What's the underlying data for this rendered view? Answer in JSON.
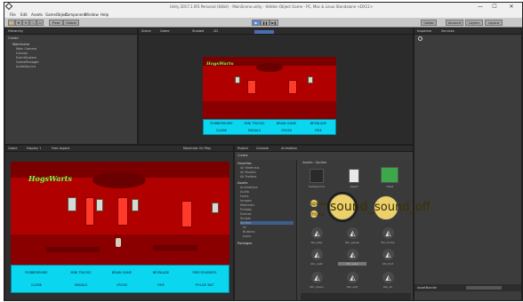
{
  "window": {
    "title": "Unity 2017.1.0f3 Personal (64bit) - MainScene.unity - Hidden Object Game - PC, Mac & Linux Standalone <DX11>",
    "minimize": "—",
    "maximize": "☐",
    "close": "✕"
  },
  "menu": [
    "File",
    "Edit",
    "Assets",
    "GameObject",
    "Component",
    "Window",
    "Help"
  ],
  "toolbar": {
    "tools": [
      "✋",
      "✥",
      "⟲",
      "⤡",
      "▭"
    ],
    "pivot": "Pivot",
    "global": "Global",
    "play": "▶",
    "pause": "❚❚",
    "step": "▶❚",
    "collab": "Collab",
    "account": "Account",
    "layers": "Layers",
    "layout": "Layout"
  },
  "hierarchy": {
    "tab": "Hierarchy",
    "create": "Create",
    "items": [
      "MainScene",
      "Main Camera",
      "Canvas",
      "EventSystem",
      "GameManager",
      "AudioSource"
    ]
  },
  "scene": {
    "tab": "Scene",
    "tab2": "Game",
    "shaded": "Shaded",
    "mode": "2D"
  },
  "game": {
    "tab": "Game",
    "display": "Display 1",
    "aspect": "Free Aspect",
    "maximize": "Maximize On Play"
  },
  "logo": "HogsWarts",
  "word_grid": [
    [
      "ROBBERSHIRE",
      "MINI TRUCKS",
      "BRAIN GAME",
      "BEYBLADE",
      "PRECIOUSNESS"
    ],
    [
      "GLOBE",
      "MEDALS",
      "CROSS",
      "FIRE",
      "POLICE BAT"
    ]
  ],
  "word_grid_small": [
    [
      "ROBBERSHIRE",
      "MINI TRUCKS",
      "BRAIN GAME",
      "BEYBLADE"
    ],
    [
      "GLOBE",
      "MEDALS",
      "CROSS",
      "FIRE"
    ]
  ],
  "project": {
    "tab": "Project",
    "tab2": "Console",
    "tab3": "Animation",
    "create": "Create",
    "folders": [
      "Favorites",
      "All Materials",
      "All Models",
      "All Prefabs",
      "Assets",
      "Animations",
      "Audio",
      "Fonts",
      "Images",
      "Materials",
      "Prefabs",
      "Scenes",
      "Scripts",
      "Sprites",
      "UI",
      "Buttons",
      "Icons",
      "Packages"
    ],
    "breadcrumb": "Assets › Sprites",
    "assets_row1": [
      "background",
      "object",
      "chest"
    ],
    "icon_labels": [
      "sound_on",
      "sound_off",
      "speaker",
      "mute"
    ],
    "unity_labels": [
      "btn_play",
      "btn_pause",
      "btn_home",
      "btn_next",
      "btn_prev",
      "btn_hint",
      "btn_menu",
      "btn_exit",
      "btn_ok"
    ]
  },
  "inspector": {
    "tab": "Inspector",
    "tab2": "Services",
    "footer": "AssetBundle"
  },
  "colors": {
    "room": "#b00000",
    "words_bg": "#0ad6f0",
    "sound_btn": "#ecd06c",
    "logo": "#6cff4a"
  }
}
